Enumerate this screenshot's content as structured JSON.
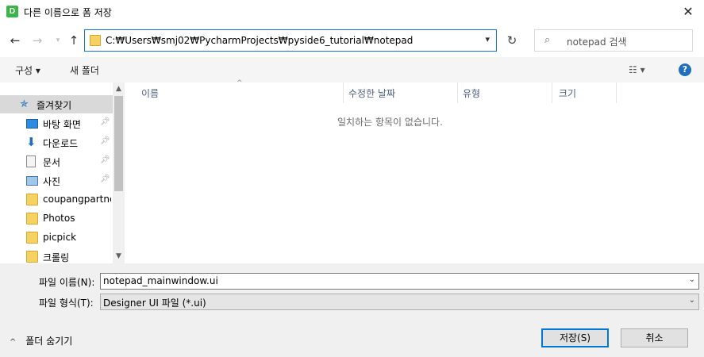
{
  "window": {
    "title": "다른 이름으로 폼 저장",
    "app_icon_letter": "D"
  },
  "address": {
    "path": "C:₩Users₩smj02₩PycharmProjects₩pyside6_tutorial₩notepad"
  },
  "search": {
    "placeholder": "notepad 검색"
  },
  "toolbar": {
    "organize_label": "구성 ▾",
    "new_folder_label": "새 폴더",
    "help_label": "?"
  },
  "sidebar": {
    "items": [
      {
        "label": "즐겨찾기",
        "icon": "star-icon",
        "pinned": false
      },
      {
        "label": "바탕 화면",
        "icon": "desktop-icon",
        "pinned": true
      },
      {
        "label": "다운로드",
        "icon": "download-icon",
        "pinned": true
      },
      {
        "label": "문서",
        "icon": "document-icon",
        "pinned": true
      },
      {
        "label": "사진",
        "icon": "picture-icon",
        "pinned": true
      },
      {
        "label": "coupangpartner",
        "icon": "folder-icon",
        "pinned": false
      },
      {
        "label": "Photos",
        "icon": "folder-icon",
        "pinned": false
      },
      {
        "label": "picpick",
        "icon": "folder-icon",
        "pinned": false
      },
      {
        "label": "크롤링",
        "icon": "folder-icon",
        "pinned": false
      }
    ]
  },
  "filelist": {
    "columns": [
      "이름",
      "수정한 날짜",
      "유형",
      "크기"
    ],
    "empty_message": "일치하는 항목이 없습니다."
  },
  "form": {
    "filename_label": "파일 이름(N):",
    "filename_value": "notepad_mainwindow.ui",
    "filetype_label": "파일 형식(T):",
    "filetype_value": "Designer UI 파일 (*.ui)"
  },
  "footer": {
    "hide_folders_label": "폴더 숨기기",
    "save_label": "저장(S)",
    "cancel_label": "취소"
  },
  "colors": {
    "accent": "#0078d7",
    "selected_bg": "#d9d9d9"
  }
}
